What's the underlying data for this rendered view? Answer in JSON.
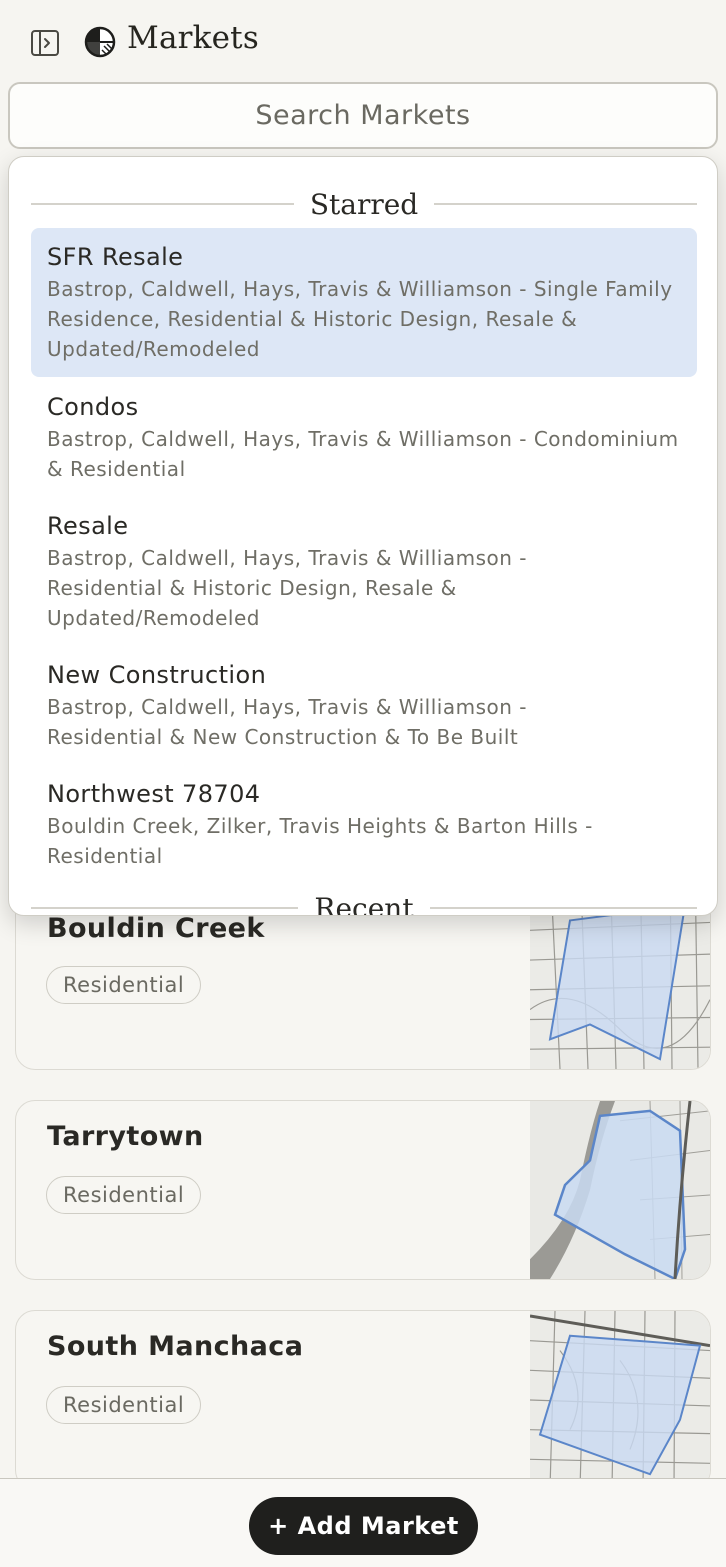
{
  "header": {
    "title": "Markets",
    "sidebar_toggle_icon": "sidebar-toggle-icon",
    "logo_icon": "markets-logo-icon"
  },
  "search": {
    "placeholder": "Search Markets"
  },
  "dropdown": {
    "starred_label": "Starred",
    "recent_label": "Recent",
    "items": [
      {
        "name": "SFR Resale",
        "desc": "Bastrop, Caldwell, Hays, Travis & Williamson - Single Family Residence, Residential & Historic Design, Resale & Updated/Remodeled"
      },
      {
        "name": "Condos",
        "desc": "Bastrop, Caldwell, Hays, Travis & Williamson - Condominium & Residential"
      },
      {
        "name": "Resale",
        "desc": "Bastrop, Caldwell, Hays, Travis & Williamson - Residential & Historic Design, Resale & Updated/Remodeled"
      },
      {
        "name": "New Construction",
        "desc": "Bastrop, Caldwell, Hays, Travis & Williamson - Residential & New Construction & To Be Built"
      },
      {
        "name": "Northwest 78704",
        "desc": "Bouldin Creek, Zilker, Travis Heights & Barton Hills - Residential"
      }
    ]
  },
  "cards": [
    {
      "name": "Bouldin Creek",
      "tag": "Residential"
    },
    {
      "name": "Tarrytown",
      "tag": "Residential"
    },
    {
      "name": "South Manchaca",
      "tag": "Residential"
    }
  ],
  "footer": {
    "add_button_label": "+ Add Market"
  },
  "colors": {
    "accent_selected": "#dde7f6",
    "map_region": "#c9daf2",
    "map_outline": "#5b86c9",
    "button_bg": "#1f1f1d"
  }
}
